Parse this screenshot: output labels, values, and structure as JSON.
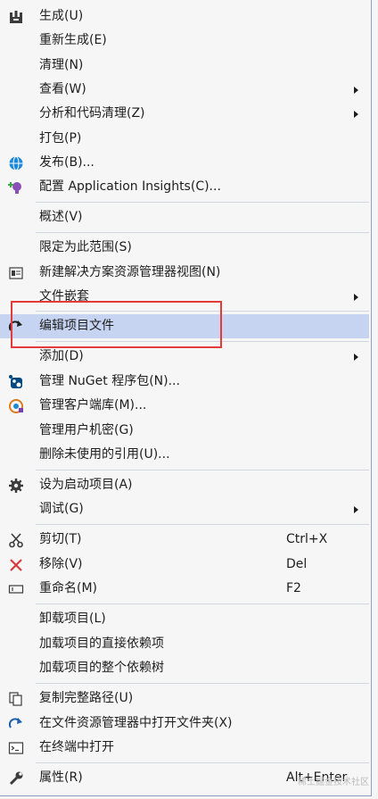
{
  "menu": {
    "build": "生成(U)",
    "rebuild": "重新生成(E)",
    "clean": "清理(N)",
    "view": "查看(W)",
    "analyze": "分析和代码清理(Z)",
    "pack": "打包(P)",
    "publish": "发布(B)...",
    "configure_ai": "配置 Application Insights(C)...",
    "overview": "概述(V)",
    "scope_to_this": "限定为此范围(S)",
    "new_solution_view": "新建解决方案资源管理器视图(N)",
    "file_nesting": "文件嵌套",
    "edit_project_file": "编辑项目文件",
    "add": "添加(D)",
    "manage_nuget": "管理 NuGet 程序包(N)...",
    "manage_client_libs": "管理客户端库(M)...",
    "manage_user_secrets": "管理用户机密(G)",
    "remove_unused_refs": "删除未使用的引用(U)...",
    "set_startup": "设为启动项目(A)",
    "debug": "调试(G)",
    "cut": "剪切(T)",
    "cut_shortcut": "Ctrl+X",
    "remove": "移除(V)",
    "remove_shortcut": "Del",
    "rename": "重命名(M)",
    "rename_shortcut": "F2",
    "unload": "卸载项目(L)",
    "load_direct_deps": "加载项目的直接依赖项",
    "load_all_deps": "加载项目的整个依赖树",
    "copy_full_path": "复制完整路径(U)",
    "open_in_explorer": "在文件资源管理器中打开文件夹(X)",
    "open_in_terminal": "在终端中打开",
    "properties": "属性(R)",
    "properties_shortcut": "Alt+Enter"
  },
  "icons": {
    "build": "build-icon",
    "publish": "globe-icon",
    "configure_ai": "lightbulb-icon",
    "new_solution_view": "solution-view-icon",
    "edit_project_file": "redo-arrow-icon",
    "manage_nuget": "nuget-icon",
    "manage_client_libs": "library-icon",
    "set_startup": "gear-icon",
    "cut": "scissors-icon",
    "remove": "x-icon",
    "rename": "rename-icon",
    "copy_full_path": "copy-icon",
    "open_in_explorer": "refresh-arrow-icon",
    "open_in_terminal": "terminal-icon",
    "properties": "wrench-icon"
  },
  "highlight_color": "#c6d4f2",
  "annotation_color": "#e53a3a",
  "watermark": "稀土掘金技术社区"
}
